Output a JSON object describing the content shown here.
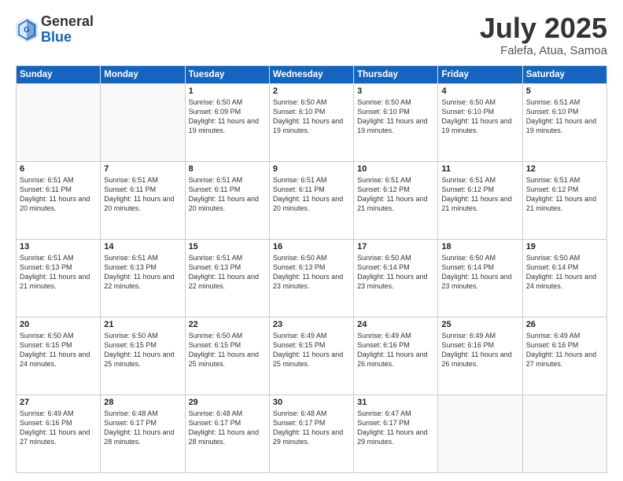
{
  "header": {
    "logo_general": "General",
    "logo_blue": "Blue",
    "month_title": "July 2025",
    "location": "Falefa, Atua, Samoa"
  },
  "days_of_week": [
    "Sunday",
    "Monday",
    "Tuesday",
    "Wednesday",
    "Thursday",
    "Friday",
    "Saturday"
  ],
  "weeks": [
    [
      {
        "day": "",
        "empty": true
      },
      {
        "day": "",
        "empty": true
      },
      {
        "day": "1",
        "sunrise": "Sunrise: 6:50 AM",
        "sunset": "Sunset: 6:09 PM",
        "daylight": "Daylight: 11 hours and 19 minutes."
      },
      {
        "day": "2",
        "sunrise": "Sunrise: 6:50 AM",
        "sunset": "Sunset: 6:10 PM",
        "daylight": "Daylight: 11 hours and 19 minutes."
      },
      {
        "day": "3",
        "sunrise": "Sunrise: 6:50 AM",
        "sunset": "Sunset: 6:10 PM",
        "daylight": "Daylight: 11 hours and 19 minutes."
      },
      {
        "day": "4",
        "sunrise": "Sunrise: 6:50 AM",
        "sunset": "Sunset: 6:10 PM",
        "daylight": "Daylight: 11 hours and 19 minutes."
      },
      {
        "day": "5",
        "sunrise": "Sunrise: 6:51 AM",
        "sunset": "Sunset: 6:10 PM",
        "daylight": "Daylight: 11 hours and 19 minutes."
      }
    ],
    [
      {
        "day": "6",
        "sunrise": "Sunrise: 6:51 AM",
        "sunset": "Sunset: 6:11 PM",
        "daylight": "Daylight: 11 hours and 20 minutes."
      },
      {
        "day": "7",
        "sunrise": "Sunrise: 6:51 AM",
        "sunset": "Sunset: 6:11 PM",
        "daylight": "Daylight: 11 hours and 20 minutes."
      },
      {
        "day": "8",
        "sunrise": "Sunrise: 6:51 AM",
        "sunset": "Sunset: 6:11 PM",
        "daylight": "Daylight: 11 hours and 20 minutes."
      },
      {
        "day": "9",
        "sunrise": "Sunrise: 6:51 AM",
        "sunset": "Sunset: 6:11 PM",
        "daylight": "Daylight: 11 hours and 20 minutes."
      },
      {
        "day": "10",
        "sunrise": "Sunrise: 6:51 AM",
        "sunset": "Sunset: 6:12 PM",
        "daylight": "Daylight: 11 hours and 21 minutes."
      },
      {
        "day": "11",
        "sunrise": "Sunrise: 6:51 AM",
        "sunset": "Sunset: 6:12 PM",
        "daylight": "Daylight: 11 hours and 21 minutes."
      },
      {
        "day": "12",
        "sunrise": "Sunrise: 6:51 AM",
        "sunset": "Sunset: 6:12 PM",
        "daylight": "Daylight: 11 hours and 21 minutes."
      }
    ],
    [
      {
        "day": "13",
        "sunrise": "Sunrise: 6:51 AM",
        "sunset": "Sunset: 6:13 PM",
        "daylight": "Daylight: 11 hours and 21 minutes."
      },
      {
        "day": "14",
        "sunrise": "Sunrise: 6:51 AM",
        "sunset": "Sunset: 6:13 PM",
        "daylight": "Daylight: 11 hours and 22 minutes."
      },
      {
        "day": "15",
        "sunrise": "Sunrise: 6:51 AM",
        "sunset": "Sunset: 6:13 PM",
        "daylight": "Daylight: 11 hours and 22 minutes."
      },
      {
        "day": "16",
        "sunrise": "Sunrise: 6:50 AM",
        "sunset": "Sunset: 6:13 PM",
        "daylight": "Daylight: 11 hours and 23 minutes."
      },
      {
        "day": "17",
        "sunrise": "Sunrise: 6:50 AM",
        "sunset": "Sunset: 6:14 PM",
        "daylight": "Daylight: 11 hours and 23 minutes."
      },
      {
        "day": "18",
        "sunrise": "Sunrise: 6:50 AM",
        "sunset": "Sunset: 6:14 PM",
        "daylight": "Daylight: 11 hours and 23 minutes."
      },
      {
        "day": "19",
        "sunrise": "Sunrise: 6:50 AM",
        "sunset": "Sunset: 6:14 PM",
        "daylight": "Daylight: 11 hours and 24 minutes."
      }
    ],
    [
      {
        "day": "20",
        "sunrise": "Sunrise: 6:50 AM",
        "sunset": "Sunset: 6:15 PM",
        "daylight": "Daylight: 11 hours and 24 minutes."
      },
      {
        "day": "21",
        "sunrise": "Sunrise: 6:50 AM",
        "sunset": "Sunset: 6:15 PM",
        "daylight": "Daylight: 11 hours and 25 minutes."
      },
      {
        "day": "22",
        "sunrise": "Sunrise: 6:50 AM",
        "sunset": "Sunset: 6:15 PM",
        "daylight": "Daylight: 11 hours and 25 minutes."
      },
      {
        "day": "23",
        "sunrise": "Sunrise: 6:49 AM",
        "sunset": "Sunset: 6:15 PM",
        "daylight": "Daylight: 11 hours and 25 minutes."
      },
      {
        "day": "24",
        "sunrise": "Sunrise: 6:49 AM",
        "sunset": "Sunset: 6:16 PM",
        "daylight": "Daylight: 11 hours and 26 minutes."
      },
      {
        "day": "25",
        "sunrise": "Sunrise: 6:49 AM",
        "sunset": "Sunset: 6:16 PM",
        "daylight": "Daylight: 11 hours and 26 minutes."
      },
      {
        "day": "26",
        "sunrise": "Sunrise: 6:49 AM",
        "sunset": "Sunset: 6:16 PM",
        "daylight": "Daylight: 11 hours and 27 minutes."
      }
    ],
    [
      {
        "day": "27",
        "sunrise": "Sunrise: 6:49 AM",
        "sunset": "Sunset: 6:16 PM",
        "daylight": "Daylight: 11 hours and 27 minutes."
      },
      {
        "day": "28",
        "sunrise": "Sunrise: 6:48 AM",
        "sunset": "Sunset: 6:17 PM",
        "daylight": "Daylight: 11 hours and 28 minutes."
      },
      {
        "day": "29",
        "sunrise": "Sunrise: 6:48 AM",
        "sunset": "Sunset: 6:17 PM",
        "daylight": "Daylight: 11 hours and 28 minutes."
      },
      {
        "day": "30",
        "sunrise": "Sunrise: 6:48 AM",
        "sunset": "Sunset: 6:17 PM",
        "daylight": "Daylight: 11 hours and 29 minutes."
      },
      {
        "day": "31",
        "sunrise": "Sunrise: 6:47 AM",
        "sunset": "Sunset: 6:17 PM",
        "daylight": "Daylight: 11 hours and 29 minutes."
      },
      {
        "day": "",
        "empty": true
      },
      {
        "day": "",
        "empty": true
      }
    ]
  ]
}
